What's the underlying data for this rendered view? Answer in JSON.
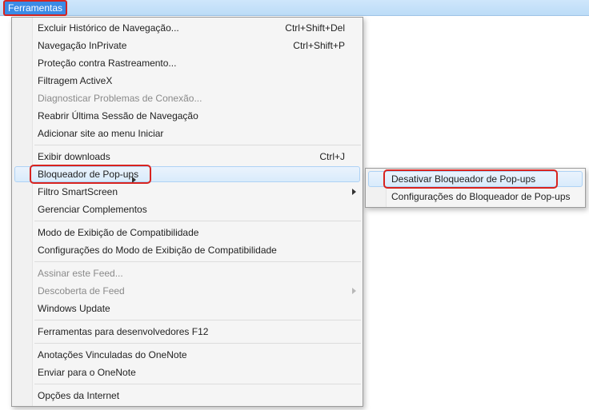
{
  "title": "Ferramentas",
  "menu": {
    "groups": [
      [
        {
          "label": "Excluir Histórico de Navegação...",
          "shortcut": "Ctrl+Shift+Del"
        },
        {
          "label": "Navegação InPrivate",
          "shortcut": "Ctrl+Shift+P"
        },
        {
          "label": "Proteção contra Rastreamento..."
        },
        {
          "label": "Filtragem ActiveX"
        },
        {
          "label": "Diagnosticar Problemas de Conexão...",
          "disabled": true
        },
        {
          "label": "Reabrir Última Sessão de Navegação"
        },
        {
          "label": "Adicionar site ao menu Iniciar"
        }
      ],
      [
        {
          "label": "Exibir downloads",
          "shortcut": "Ctrl+J"
        },
        {
          "label": "Bloqueador de Pop-ups",
          "submenu": true,
          "highlight": true,
          "redbox": true
        },
        {
          "label": "Filtro SmartScreen",
          "submenu": true
        },
        {
          "label": "Gerenciar Complementos"
        }
      ],
      [
        {
          "label": "Modo de Exibição de Compatibilidade"
        },
        {
          "label": "Configurações do Modo de Exibição de Compatibilidade"
        }
      ],
      [
        {
          "label": "Assinar este Feed...",
          "disabled": true
        },
        {
          "label": "Descoberta de Feed",
          "submenu": true,
          "disabled": true
        },
        {
          "label": "Windows Update"
        }
      ],
      [
        {
          "label": "Ferramentas para desenvolvedores F12"
        }
      ],
      [
        {
          "label": "Anotações Vinculadas do OneNote"
        },
        {
          "label": "Enviar para o OneNote"
        }
      ],
      [
        {
          "label": "Opções da Internet"
        }
      ]
    ]
  },
  "submenu": {
    "items": [
      {
        "label": "Desativar Bloqueador de Pop-ups",
        "highlight": true,
        "redbox": true
      },
      {
        "label": "Configurações do Bloqueador de Pop-ups"
      }
    ]
  }
}
